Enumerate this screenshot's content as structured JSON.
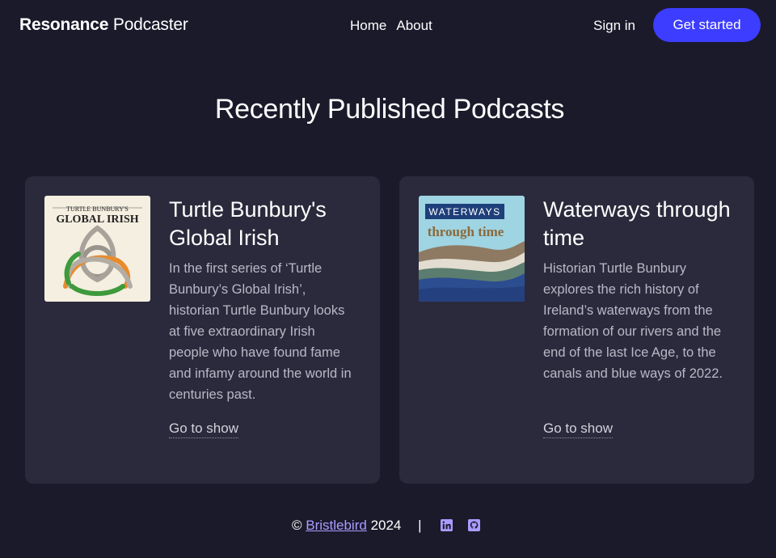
{
  "nav": {
    "brand_bold": "Resonance",
    "brand_light": "Podcaster",
    "links": [
      "Home",
      "About"
    ],
    "signin_label": "Sign in",
    "cta_label": "Get started"
  },
  "headline": "Recently Published Podcasts",
  "podcasts": [
    {
      "title": "Turtle Bunbury's Global Irish",
      "description": "In the first series of ‘Turtle Bunbury’s Global Irish’, historian Turtle Bunbury looks at five extraordinary Irish people who have found fame and infamy around the world in centuries past.",
      "link_label": "Go to show",
      "cover": {
        "line1": "TURTLE BUNBURY'S",
        "line2": "GLOBAL IRISH"
      }
    },
    {
      "title": "Waterways through time",
      "description": "Historian Turtle Bunbury explores the rich history of Ireland’s waterways from the formation of our rivers and the end of the last Ice Age, to the canals and blue ways of 2022.",
      "link_label": "Go to show",
      "cover": {
        "line1": "WATERWAYS",
        "line2": "through time"
      }
    }
  ],
  "footer": {
    "copyright_symbol": "©",
    "company": "Bristlebird",
    "year": "2024",
    "separator": "|",
    "social": [
      "linkedin-icon",
      "github-icon"
    ]
  },
  "colors": {
    "background": "#1b1a2b",
    "card": "#2b2a3c",
    "accent": "#3d3dff",
    "link": "#a99cff"
  }
}
